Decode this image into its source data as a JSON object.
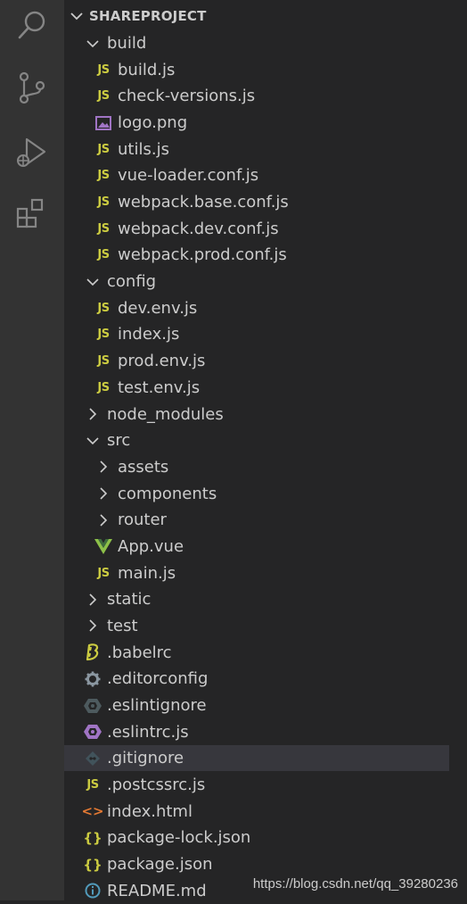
{
  "explorer": {
    "section_title": "SHAREPROJECT",
    "tree": [
      {
        "label": "build",
        "type": "folder",
        "expanded": true,
        "indent": 1,
        "icon": "chevron-down-icon"
      },
      {
        "label": "build.js",
        "type": "file",
        "indent": 2,
        "icon": "js-icon"
      },
      {
        "label": "check-versions.js",
        "type": "file",
        "indent": 2,
        "icon": "js-icon"
      },
      {
        "label": "logo.png",
        "type": "file",
        "indent": 2,
        "icon": "image-icon"
      },
      {
        "label": "utils.js",
        "type": "file",
        "indent": 2,
        "icon": "js-icon"
      },
      {
        "label": "vue-loader.conf.js",
        "type": "file",
        "indent": 2,
        "icon": "js-icon"
      },
      {
        "label": "webpack.base.conf.js",
        "type": "file",
        "indent": 2,
        "icon": "js-icon"
      },
      {
        "label": "webpack.dev.conf.js",
        "type": "file",
        "indent": 2,
        "icon": "js-icon"
      },
      {
        "label": "webpack.prod.conf.js",
        "type": "file",
        "indent": 2,
        "icon": "js-icon"
      },
      {
        "label": "config",
        "type": "folder",
        "expanded": true,
        "indent": 1,
        "icon": "chevron-down-icon"
      },
      {
        "label": "dev.env.js",
        "type": "file",
        "indent": 2,
        "icon": "js-icon"
      },
      {
        "label": "index.js",
        "type": "file",
        "indent": 2,
        "icon": "js-icon"
      },
      {
        "label": "prod.env.js",
        "type": "file",
        "indent": 2,
        "icon": "js-icon"
      },
      {
        "label": "test.env.js",
        "type": "file",
        "indent": 2,
        "icon": "js-icon"
      },
      {
        "label": "node_modules",
        "type": "folder",
        "expanded": false,
        "indent": 1,
        "icon": "chevron-right-icon"
      },
      {
        "label": "src",
        "type": "folder",
        "expanded": true,
        "indent": 1,
        "icon": "chevron-down-icon"
      },
      {
        "label": "assets",
        "type": "folder",
        "expanded": false,
        "indent": 2,
        "icon": "chevron-right-icon"
      },
      {
        "label": "components",
        "type": "folder",
        "expanded": false,
        "indent": 2,
        "icon": "chevron-right-icon"
      },
      {
        "label": "router",
        "type": "folder",
        "expanded": false,
        "indent": 2,
        "icon": "chevron-right-icon"
      },
      {
        "label": "App.vue",
        "type": "file",
        "indent": 2,
        "icon": "vue-icon"
      },
      {
        "label": "main.js",
        "type": "file",
        "indent": 2,
        "icon": "js-icon"
      },
      {
        "label": "static",
        "type": "folder",
        "expanded": false,
        "indent": 1,
        "icon": "chevron-right-icon"
      },
      {
        "label": "test",
        "type": "folder",
        "expanded": false,
        "indent": 1,
        "icon": "chevron-right-icon"
      },
      {
        "label": ".babelrc",
        "type": "file",
        "indent": 1,
        "icon": "babel-icon"
      },
      {
        "label": ".editorconfig",
        "type": "file",
        "indent": 1,
        "icon": "gear-icon"
      },
      {
        "label": ".eslintignore",
        "type": "file",
        "indent": 1,
        "icon": "eslint-ignore-icon"
      },
      {
        "label": ".eslintrc.js",
        "type": "file",
        "indent": 1,
        "icon": "eslint-icon"
      },
      {
        "label": ".gitignore",
        "type": "file",
        "indent": 1,
        "icon": "git-icon",
        "selected": true
      },
      {
        "label": ".postcssrc.js",
        "type": "file",
        "indent": 1,
        "icon": "js-icon"
      },
      {
        "label": "index.html",
        "type": "file",
        "indent": 1,
        "icon": "html-icon"
      },
      {
        "label": "package-lock.json",
        "type": "file",
        "indent": 1,
        "icon": "json-icon"
      },
      {
        "label": "package.json",
        "type": "file",
        "indent": 1,
        "icon": "json-icon"
      },
      {
        "label": "README.md",
        "type": "file",
        "indent": 1,
        "icon": "info-icon"
      }
    ]
  },
  "activity_bar": [
    "search-icon",
    "source-control-icon",
    "run-debug-icon",
    "extensions-icon"
  ],
  "watermark": "https://blog.csdn.net/qq_39280236",
  "colors": {
    "activity_bar": "#333333",
    "sidebar": "#252526",
    "text": "#cccccc",
    "js": "#cbcb41",
    "vue": "#8dc149",
    "selected_row": "#37373d"
  }
}
